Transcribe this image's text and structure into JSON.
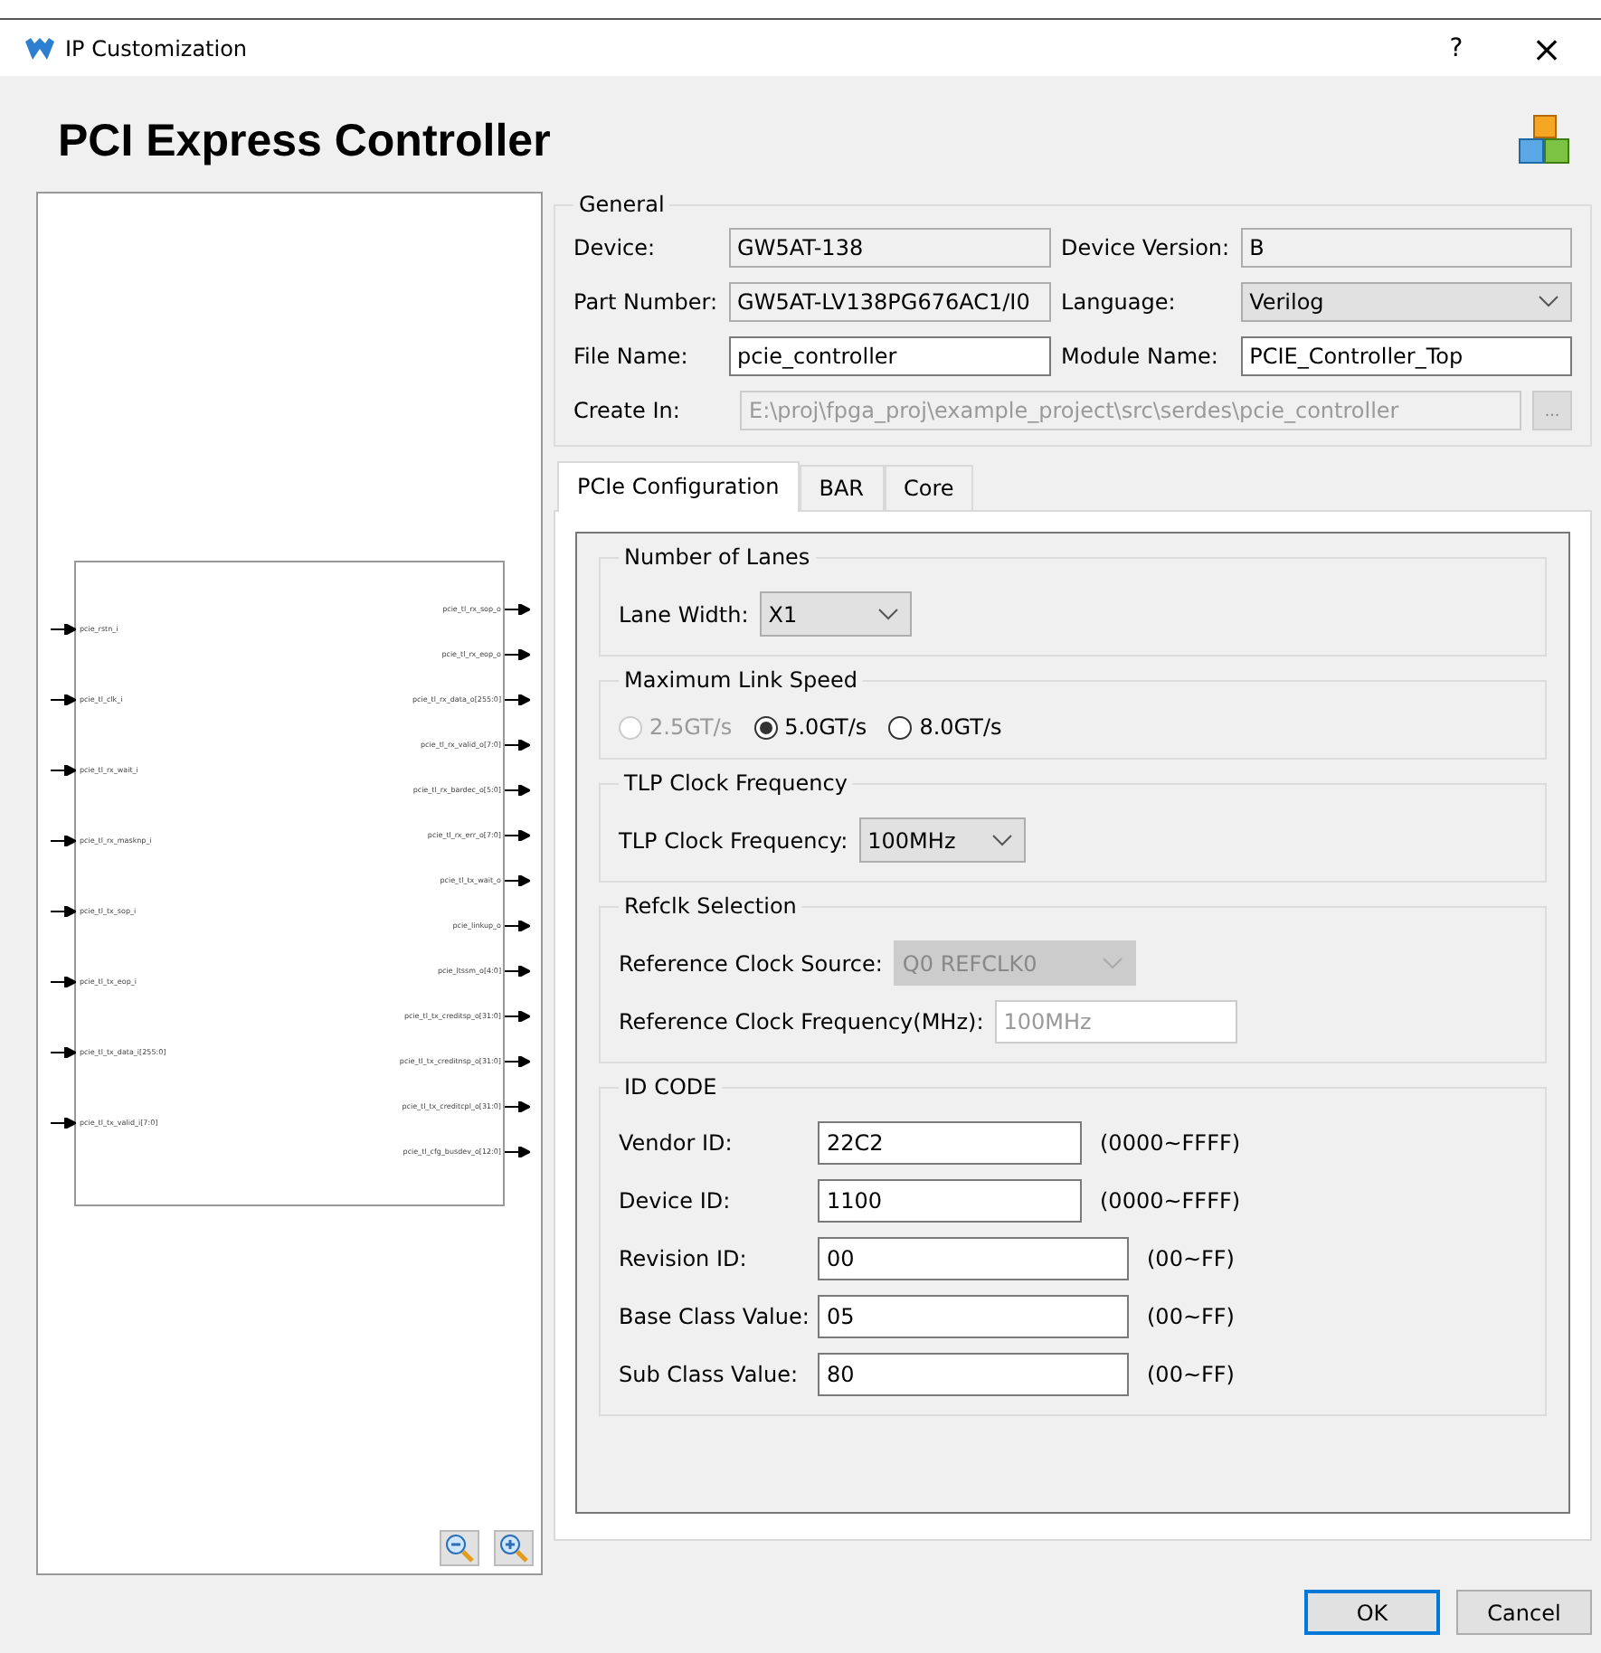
{
  "window": {
    "title": "IP Customization",
    "help": "?",
    "close": "×"
  },
  "heading": "PCI Express Controller",
  "symbol": {
    "inputs": [
      "pcie_rstn_i",
      "pcie_tl_clk_i",
      "pcie_tl_rx_wait_i",
      "pcie_tl_rx_masknp_i",
      "pcie_tl_tx_sop_i",
      "pcie_tl_tx_eop_i",
      "pcie_tl_tx_data_i[255:0]",
      "pcie_tl_tx_valid_i[7:0]"
    ],
    "outputs": [
      "pcie_tl_rx_sop_o",
      "pcie_tl_rx_eop_o",
      "pcie_tl_rx_data_o[255:0]",
      "pcie_tl_rx_valid_o[7:0]",
      "pcie_tl_rx_bardec_o[5:0]",
      "pcie_tl_rx_err_o[7:0]",
      "pcie_tl_tx_wait_o",
      "pcie_linkup_o",
      "pcie_ltssm_o[4:0]",
      "pcie_tl_tx_creditsp_o[31:0]",
      "pcie_tl_tx_creditnsp_o[31:0]",
      "pcie_tl_tx_creditcpl_o[31:0]",
      "pcie_tl_cfg_busdev_o[12:0]"
    ]
  },
  "general": {
    "title": "General",
    "fields": [
      {
        "label": "Device:",
        "value": "GW5AT-138",
        "kind": "readonly"
      },
      {
        "label": "Device Version:",
        "value": "B",
        "kind": "readonly"
      },
      {
        "label": "Part Number:",
        "value": "GW5AT-LV138PG676AC1/I0",
        "kind": "readonly"
      },
      {
        "label": "Language:",
        "value": "Verilog",
        "kind": "select"
      },
      {
        "label": "File Name:",
        "value": "pcie_controller",
        "kind": "text"
      },
      {
        "label": "Module Name:",
        "value": "PCIE_Controller_Top",
        "kind": "text"
      }
    ],
    "create_in": {
      "label": "Create In:",
      "value": "E:\\proj\\fpga_proj\\example_project\\src\\serdes\\pcie_controller",
      "browse": "..."
    }
  },
  "tabs": [
    {
      "label": "PCIe Configuration",
      "selected": true
    },
    {
      "label": "BAR",
      "selected": false
    },
    {
      "label": "Core",
      "selected": false
    }
  ],
  "groups": [
    {
      "title": "Number of Lanes",
      "rows": [
        {
          "kind": "select",
          "label": "Lane Width:",
          "value": "X1",
          "disabled": false
        }
      ]
    },
    {
      "title": "Maximum Link Speed",
      "rows": [
        {
          "kind": "radio",
          "options": [
            {
              "label": "2.5GT/s",
              "selected": false,
              "disabled": true
            },
            {
              "label": "5.0GT/s",
              "selected": true,
              "disabled": false
            },
            {
              "label": "8.0GT/s",
              "selected": false,
              "disabled": false
            }
          ]
        }
      ]
    },
    {
      "title": "TLP Clock Frequency",
      "rows": [
        {
          "kind": "select",
          "label": "TLP Clock Frequency:",
          "value": "100MHz",
          "disabled": false
        }
      ]
    },
    {
      "title": "Refclk Selection",
      "rows": [
        {
          "kind": "select",
          "label": "Reference Clock Source:",
          "value": "Q0 REFCLK0",
          "disabled": true
        },
        {
          "kind": "text",
          "label": "Reference Clock Frequency(MHz):",
          "value": "100MHz",
          "disabled": true
        }
      ]
    },
    {
      "title": "ID CODE",
      "rows": [
        {
          "kind": "text",
          "label": "Vendor ID:",
          "value": "22C2",
          "disabled": false,
          "range": "(0000~FFFF)"
        },
        {
          "kind": "text",
          "label": "Device ID:",
          "value": "1100",
          "disabled": false,
          "range": "(0000~FFFF)"
        },
        {
          "kind": "text",
          "label": "Revision ID:",
          "value": "00",
          "disabled": false,
          "range": "(00~FF)",
          "wide": true
        },
        {
          "kind": "text",
          "label": "Base Class Value:",
          "value": "05",
          "disabled": false,
          "range": "(00~FF)",
          "wide": true
        },
        {
          "kind": "text",
          "label": "Sub Class Value:",
          "value": "80",
          "disabled": false,
          "range": "(00~FF)",
          "wide": true
        }
      ]
    }
  ],
  "buttons": [
    {
      "label": "OK",
      "default": true
    },
    {
      "label": "Cancel",
      "default": false
    }
  ]
}
